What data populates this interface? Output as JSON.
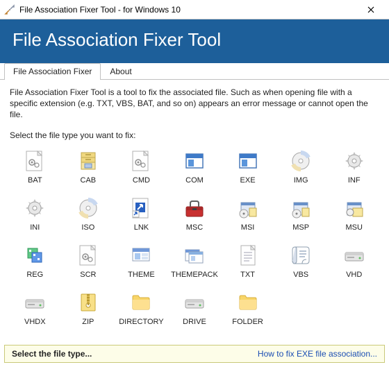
{
  "window": {
    "title": "File Association Fixer Tool - for Windows 10"
  },
  "header": {
    "title": "File Association Fixer Tool"
  },
  "tabs": [
    {
      "label": "File Association Fixer",
      "active": true
    },
    {
      "label": "About",
      "active": false
    }
  ],
  "body": {
    "description": "File Association Fixer Tool is a tool to fix the associated file. Such as when opening file with a specific extension (e.g. TXT, VBS, BAT, and so on) appears an error message or cannot open the file.",
    "select_prompt": "Select the file type you want to fix:"
  },
  "items": [
    {
      "label": "BAT",
      "icon": "gear-doc-icon"
    },
    {
      "label": "CAB",
      "icon": "cabinet-icon"
    },
    {
      "label": "CMD",
      "icon": "gear-doc-icon"
    },
    {
      "label": "COM",
      "icon": "window-icon"
    },
    {
      "label": "EXE",
      "icon": "window-icon"
    },
    {
      "label": "IMG",
      "icon": "disc-icon"
    },
    {
      "label": "INF",
      "icon": "gear-icon"
    },
    {
      "label": "INI",
      "icon": "gear-icon"
    },
    {
      "label": "ISO",
      "icon": "disc-icon"
    },
    {
      "label": "LNK",
      "icon": "shortcut-icon"
    },
    {
      "label": "MSC",
      "icon": "toolbox-icon"
    },
    {
      "label": "MSI",
      "icon": "installer-icon"
    },
    {
      "label": "MSP",
      "icon": "installer-icon"
    },
    {
      "label": "MSU",
      "icon": "update-icon"
    },
    {
      "label": "REG",
      "icon": "registry-icon"
    },
    {
      "label": "SCR",
      "icon": "gear-doc-icon"
    },
    {
      "label": "THEME",
      "icon": "theme-icon"
    },
    {
      "label": "THEMEPACK",
      "icon": "themepack-icon"
    },
    {
      "label": "TXT",
      "icon": "text-doc-icon"
    },
    {
      "label": "VBS",
      "icon": "script-icon"
    },
    {
      "label": "VHD",
      "icon": "drive-icon"
    },
    {
      "label": "VHDX",
      "icon": "drive-icon"
    },
    {
      "label": "ZIP",
      "icon": "zip-icon"
    },
    {
      "label": "DIRECTORY",
      "icon": "folder-icon"
    },
    {
      "label": "DRIVE",
      "icon": "drive-icon"
    },
    {
      "label": "FOLDER",
      "icon": "folder-icon"
    }
  ],
  "status": {
    "left": "Select the file type...",
    "right": "How to fix EXE file association..."
  }
}
